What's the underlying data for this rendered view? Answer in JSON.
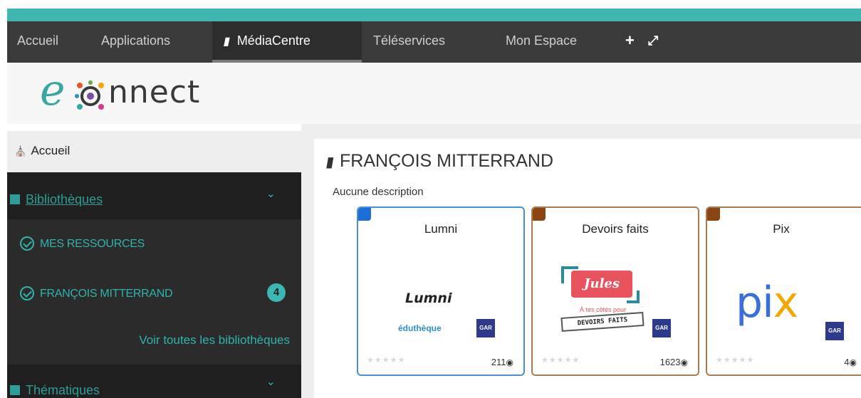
{
  "nav": {
    "items": [
      {
        "label": "Accueil"
      },
      {
        "label": "Applications"
      },
      {
        "label": "MédiaCentre",
        "active": true
      },
      {
        "label": "Téléservices"
      },
      {
        "label": "Mon Espace"
      }
    ],
    "icons": [
      "plus-icon",
      "expand-icon"
    ]
  },
  "logo": {
    "e": "e",
    "text": "nnect"
  },
  "sidebar": {
    "home": "Accueil",
    "sections": [
      {
        "label": "Bibliothèques"
      },
      {
        "label": "Thématiques"
      }
    ],
    "rows": [
      {
        "label": "MES RESSOURCES"
      },
      {
        "label": "FRANÇOIS MITTERRAND",
        "badge": "4"
      }
    ],
    "link": "Voir toutes les bibliothèques"
  },
  "panel": {
    "title": "FRANÇOIS MITTERRAND",
    "description": "Aucune description"
  },
  "cards": [
    {
      "title": "Lumni",
      "views": "211",
      "accent": "#1b6fd6",
      "border": "#4a90d9",
      "logo_text": "Lumni",
      "sub_text": "éduthèque",
      "gar": "GAR"
    },
    {
      "title": "Devoirs faits",
      "views": "1623",
      "accent": "#8b4513",
      "border": "#b07a4f",
      "logo_text": "Jules",
      "sub_text": "À tes côtés pour",
      "box_text": "DEVOIRS FAITS",
      "gar": "GAR"
    },
    {
      "title": "Pix",
      "views": "4",
      "accent": "#8b4513",
      "border": "#b07a4f",
      "logo_text": "pi",
      "logo_x": "x",
      "gar": "GAR"
    }
  ],
  "colors": {
    "teal": "#3fb6b0",
    "nav_bg": "#3b3b3b",
    "sidebar_accent": "#2fb3ad"
  }
}
